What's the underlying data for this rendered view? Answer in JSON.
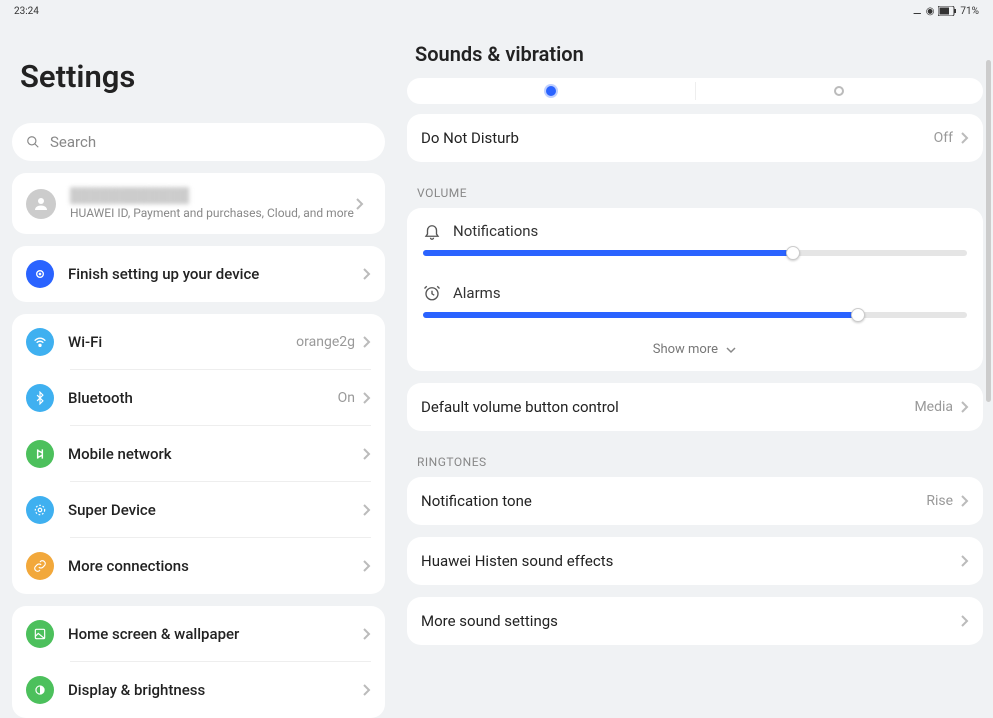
{
  "status": {
    "time": "23:24",
    "battery": "71%"
  },
  "sidebar": {
    "title": "Settings",
    "search_placeholder": "Search",
    "account": {
      "name": "████████████",
      "subtitle": "HUAWEI ID, Payment and purchases, Cloud, and more"
    },
    "finish_setup": "Finish setting up your device",
    "groups": [
      {
        "items": [
          {
            "id": "wifi",
            "label": "Wi-Fi",
            "value": "orange2g",
            "icon": "wifi",
            "color": "#3fb0f0"
          },
          {
            "id": "bluetooth",
            "label": "Bluetooth",
            "value": "On",
            "icon": "bluetooth",
            "color": "#3fb0f0"
          },
          {
            "id": "mobilenet",
            "label": "Mobile network",
            "value": "",
            "icon": "mobile",
            "color": "#4cc05c"
          },
          {
            "id": "superdev",
            "label": "Super Device",
            "value": "",
            "icon": "super",
            "color": "#3fb0f0"
          },
          {
            "id": "moreconn",
            "label": "More connections",
            "value": "",
            "icon": "link",
            "color": "#f2a83b"
          }
        ]
      },
      {
        "items": [
          {
            "id": "homescreen",
            "label": "Home screen & wallpaper",
            "value": "",
            "icon": "gallery",
            "color": "#4cc05c"
          },
          {
            "id": "display",
            "label": "Display & brightness",
            "value": "",
            "icon": "display",
            "color": "#4cc05c"
          }
        ]
      }
    ]
  },
  "content": {
    "title": "Sounds & vibration",
    "dnd": {
      "label": "Do Not Disturb",
      "value": "Off"
    },
    "section_volume": "VOLUME",
    "sliders": {
      "notifications": {
        "label": "Notifications",
        "percent": 68
      },
      "alarms": {
        "label": "Alarms",
        "percent": 80
      }
    },
    "show_more": "Show more",
    "default_volume": {
      "label": "Default volume button control",
      "value": "Media"
    },
    "section_ringtones": "RINGTONES",
    "notification_tone": {
      "label": "Notification tone",
      "value": "Rise"
    },
    "histen": "Huawei Histen sound effects",
    "more_sound": "More sound settings"
  }
}
